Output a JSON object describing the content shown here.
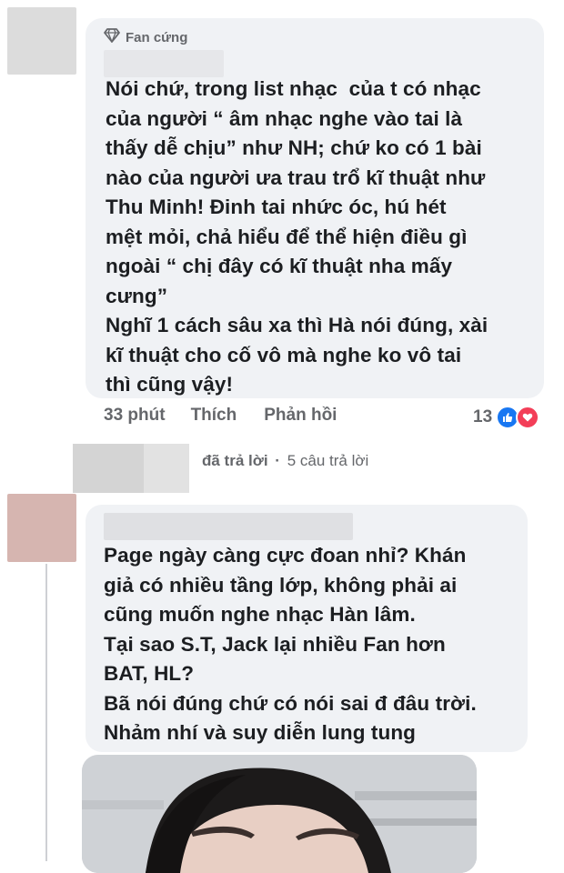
{
  "comment1": {
    "badge_label": "Fan cứng",
    "badge_icon": "diamond-icon",
    "text": "Nói chứ, trong list nhạc  của t có nhạc\ncủa người “ âm nhạc nghe vào tai là\nthấy dễ chịu” như NH; chứ ko có 1 bài\nnào của người ưa trau trổ kĩ thuật như\nThu Minh! Đinh tai nhức óc, hú hét\nmệt mỏi, chả hiểu để thể hiện điều gì\nngoài “ chị đây có kĩ thuật nha mấy\ncưng”\nNghĩ 1 cách sâu xa thì Hà nói đúng, xài\nkĩ thuật cho cố vô mà nghe ko vô tai\nthì cũng vậy!",
    "time": "33 phút",
    "like_label": "Thích",
    "reply_label": "Phản hồi",
    "reaction_count": "13",
    "reaction_icons": [
      "like-icon",
      "love-icon"
    ]
  },
  "replies": {
    "replied_label": "đã trả lời",
    "separator": "·",
    "count_label": "5 câu trả lời"
  },
  "comment2": {
    "text": "Page ngày càng cực đoan nhỉ? Khán\ngiả có nhiều tầng lớp, không phải ai\ncũng muốn nghe nhạc Hàn lâm.\nTại sao S.T, Jack lại nhiều Fan hơn\nBAT, HL?\nBã nói đúng chứ có nói sai đ đâu trời.\nNhảm nhí và suy diễn lung tung"
  },
  "colors": {
    "bubble": "#f0f2f5",
    "meta_text": "#65676b",
    "like_blue": "#1877f2",
    "love_red": "#f33e58",
    "avatar1": "#dcdcdc",
    "avatar2": "#d6b5b0"
  }
}
